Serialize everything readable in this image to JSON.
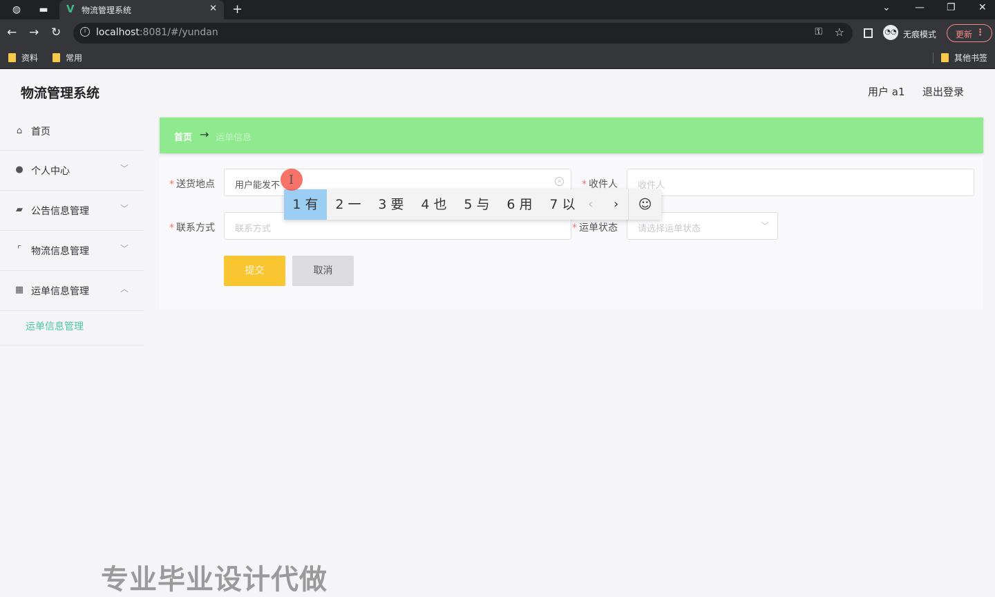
{
  "browser": {
    "tab_title": "物流管理系统",
    "url_host": "localhost",
    "url_rest": ":8081/#/yundan",
    "incognito_label": "无痕模式",
    "update_label": "更新",
    "bookmarks": [
      "资料",
      "常用"
    ],
    "other_bookmarks": "其他书签"
  },
  "app": {
    "brand": "物流管理系统",
    "user_info": "用户 a1",
    "logout": "退出登录"
  },
  "sidebar": {
    "items": [
      {
        "label": "首页",
        "icon": "home-icon"
      },
      {
        "label": "个人中心",
        "icon": "user-icon"
      },
      {
        "label": "公告信息管理",
        "icon": "notice-icon"
      },
      {
        "label": "物流信息管理",
        "icon": "crop-icon"
      },
      {
        "label": "运单信息管理",
        "icon": "grid-icon"
      }
    ],
    "submenu_label": "运单信息管理"
  },
  "breadcrumb": {
    "home": "首页",
    "arrow": "→",
    "current": "运单信息"
  },
  "form": {
    "address_label": "送货地点",
    "address_value": "用户能发不",
    "recipient_label": "收件人",
    "recipient_placeholder": "收件人",
    "contact_label": "联系方式",
    "contact_placeholder": "联系方式",
    "status_label": "运单状态",
    "status_placeholder": "请选择运单状态",
    "submit_label": "提交",
    "cancel_label": "取消"
  },
  "ime": {
    "candidates": [
      "1 有",
      "2 一",
      "3 要",
      "4 也",
      "5 与",
      "6 用",
      "7 以"
    ]
  },
  "watermark": "专业毕业设计代做"
}
